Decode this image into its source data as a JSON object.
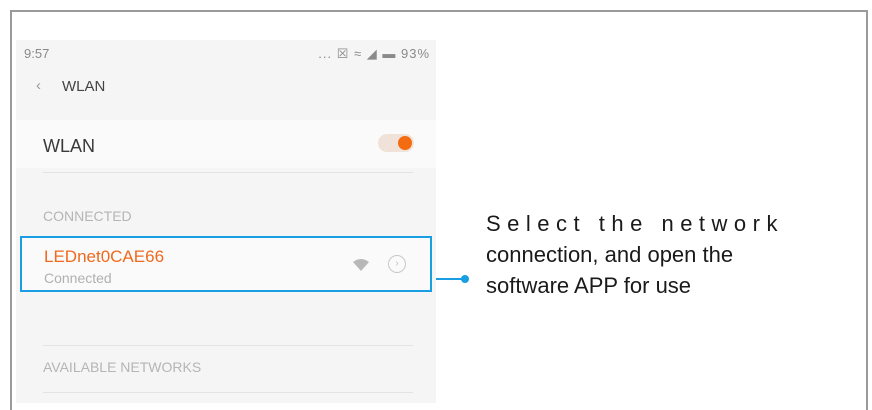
{
  "status_bar": {
    "time": "9:57",
    "icons": "... ☒ ≈ ◢ ▬ 93%"
  },
  "nav": {
    "back_icon": "‹",
    "title": "WLAN"
  },
  "wlan_toggle": {
    "label": "WLAN",
    "state": "on",
    "accent_color": "#f36c12"
  },
  "sections": {
    "connected": "CONNECTED",
    "available": "AVAILABLE NETWORKS"
  },
  "connected_network": {
    "name": "LEDnet0CAE66",
    "status": "Connected",
    "signal_icon": "wifi-icon",
    "detail_icon": "chevron-right-icon",
    "highlight_color": "#1a9ee3"
  },
  "caption": {
    "line1": "Select the network",
    "line2": "connection, and open the",
    "line3": "software APP for use"
  }
}
